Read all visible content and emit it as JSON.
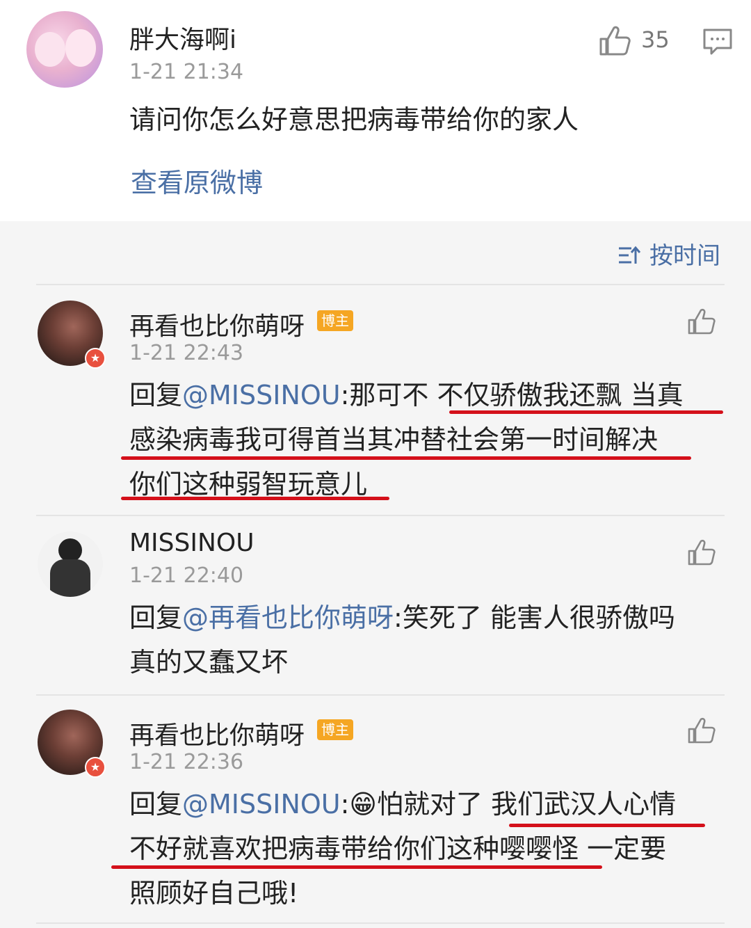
{
  "main_comment": {
    "author": "胖大海啊i",
    "time": "1-21 21:34",
    "likes": "35",
    "text": "请问你怎么好意思把病毒带给你的家人",
    "view_original": "查看原微博"
  },
  "sort_label": "按时间",
  "replies": [
    {
      "author": "再看也比你萌呀",
      "badge": "博主",
      "time": "1-21 22:43",
      "prefix": "回复",
      "mention": "@MISSINOU",
      "line1": ":那可不 不仅骄傲我还飘 当真",
      "line2": "感染病毒我可得首当其冲替社会第一时间解决",
      "line3": "你们这种弱智玩意儿"
    },
    {
      "author": "MISSINOU",
      "time": "1-21 22:40",
      "prefix": "回复",
      "mention": "@再看也比你萌呀",
      "line1": ":笑死了 能害人很骄傲吗",
      "line2": "真的又蠢又坏"
    },
    {
      "author": "再看也比你萌呀",
      "badge": "博主",
      "time": "1-21 22:36",
      "prefix": "回复",
      "mention": "@MISSINOU",
      "line1": ":😁怕就对了 我们武汉人心情",
      "line2": "不好就喜欢把病毒带给你们这种嘤嘤怪 一定要",
      "line3": "照顾好自己哦!"
    }
  ],
  "colors": {
    "link": "#4a6fa5",
    "badge": "#f5a623",
    "underline": "#d4101a"
  }
}
